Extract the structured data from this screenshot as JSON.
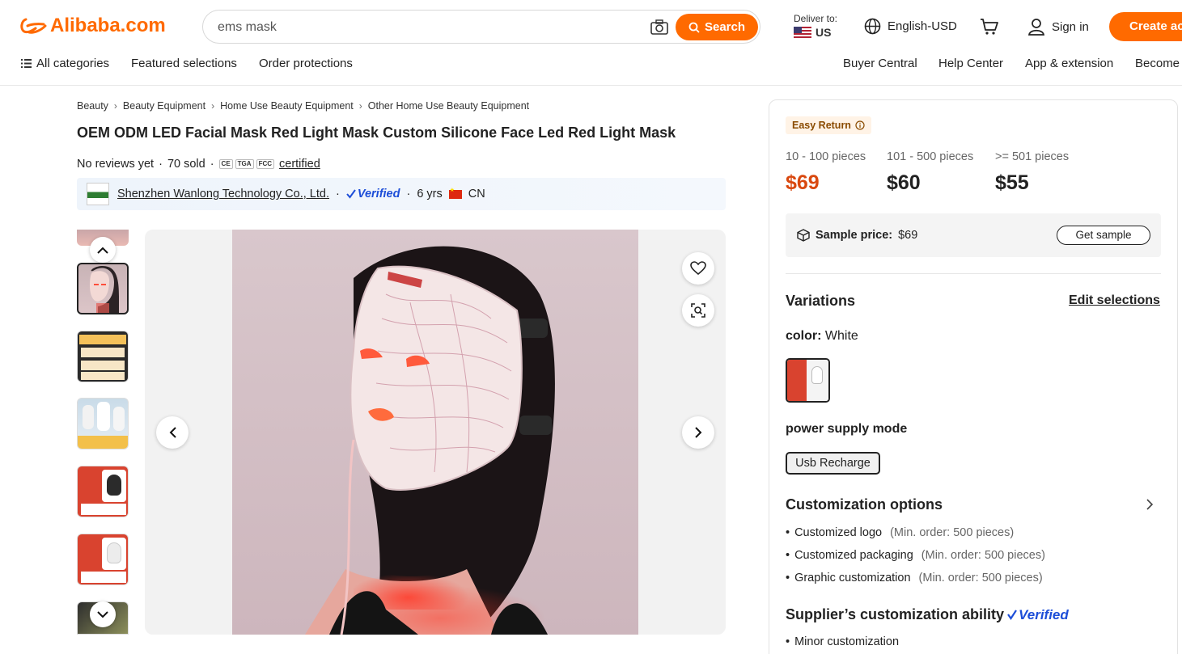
{
  "header": {
    "logo_text": "Alibaba.com",
    "search_value": "ems mask",
    "search_button": "Search",
    "deliver_label": "Deliver to:",
    "deliver_country": "US",
    "language": "English-USD",
    "sign_in": "Sign in",
    "create_account": "Create ac"
  },
  "subnav": {
    "all_categories": "All categories",
    "featured": "Featured selections",
    "order_protections": "Order protections",
    "buyer_central": "Buyer Central",
    "help_center": "Help Center",
    "app_extension": "App & extension",
    "become": "Become"
  },
  "breadcrumb": [
    "Beauty",
    "Beauty Equipment",
    "Home Use Beauty Equipment",
    "Other Home Use Beauty Equipment"
  ],
  "product": {
    "title": "OEM ODM LED Facial Mask Red Light Mask Custom Silicone Face Led Red Light Mask",
    "reviews": "No reviews yet",
    "sold": "70 sold",
    "certs": [
      "CE",
      "TGA",
      "FCC"
    ],
    "certified": "certified"
  },
  "supplier": {
    "name": "Shenzhen Wanlong Technology Co., Ltd.",
    "verified": "Verified",
    "years": "6 yrs",
    "country": "CN"
  },
  "pricing": {
    "easy_return": "Easy Return",
    "tiers": [
      {
        "range": "10 - 100 pieces",
        "price": "$69"
      },
      {
        "range": "101 - 500 pieces",
        "price": "$60"
      },
      {
        "range": ">= 501 pieces",
        "price": "$55"
      }
    ],
    "sample_label": "Sample price:",
    "sample_price": "$69",
    "get_sample": "Get sample"
  },
  "variations": {
    "title": "Variations",
    "edit": "Edit selections",
    "color_label": "color:",
    "color_value": "White",
    "power_label": "power supply mode",
    "power_option": "Usb Recharge"
  },
  "customization": {
    "title": "Customization options",
    "items": [
      {
        "name": "Customized logo",
        "min": "(Min. order: 500 pieces)"
      },
      {
        "name": "Customized packaging",
        "min": "(Min. order: 500 pieces)"
      },
      {
        "name": "Graphic customization",
        "min": "(Min. order: 500 pieces)"
      }
    ],
    "ability_title": "Supplier’s customization ability",
    "ability_verified": "Verified",
    "ability_items": [
      "Minor customization"
    ]
  },
  "colors": {
    "brand": "#ff6a00",
    "price_highlight": "#d9480f",
    "verified": "#1d4ed8"
  }
}
